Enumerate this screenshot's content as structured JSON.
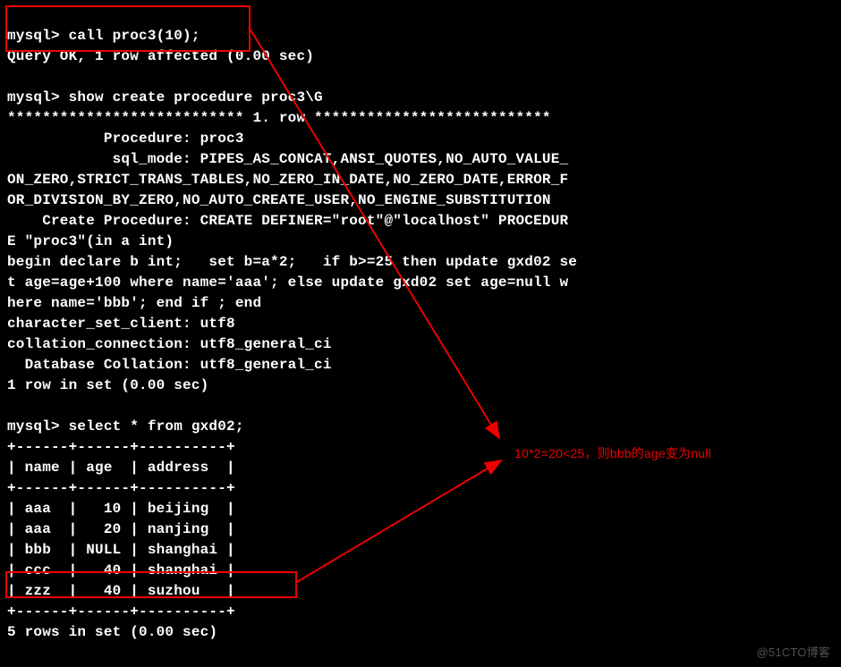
{
  "terminal": {
    "lines": [
      "mysql> call proc3(10);",
      "Query OK, 1 row affected (0.00 sec)",
      "",
      "mysql> show create procedure proc3\\G",
      "*************************** 1. row ***************************",
      "           Procedure: proc3",
      "            sql_mode: PIPES_AS_CONCAT,ANSI_QUOTES,NO_AUTO_VALUE_",
      "ON_ZERO,STRICT_TRANS_TABLES,NO_ZERO_IN_DATE,NO_ZERO_DATE,ERROR_F",
      "OR_DIVISION_BY_ZERO,NO_AUTO_CREATE_USER,NO_ENGINE_SUBSTITUTION",
      "    Create Procedure: CREATE DEFINER=\"root\"@\"localhost\" PROCEDUR",
      "E \"proc3\"(in a int)",
      "begin declare b int;   set b=a*2;   if b>=25 then update gxd02 se",
      "t age=age+100 where name='aaa'; else update gxd02 set age=null w",
      "here name='bbb'; end if ; end",
      "character_set_client: utf8",
      "collation_connection: utf8_general_ci",
      "  Database Collation: utf8_general_ci",
      "1 row in set (0.00 sec)",
      "",
      "mysql> select * from gxd02;",
      "+------+------+----------+",
      "| name | age  | address  |",
      "+------+------+----------+",
      "| aaa  |   10 | beijing  |",
      "| aaa  |   20 | nanjing  |",
      "| bbb  | NULL | shanghai |",
      "| ccc  |   40 | shanghai |",
      "| zzz  |   40 | suzhou   |",
      "+------+------+----------+",
      "5 rows in set (0.00 sec)"
    ]
  },
  "annotation": {
    "text": "10*2=20<25，则bbb的age变为null"
  },
  "watermark": "@51CTO博客",
  "commands": {
    "call": "call proc3(10);",
    "show": "show create procedure proc3\\G",
    "select": "select * from gxd02;"
  },
  "procedure": {
    "name": "proc3",
    "sql_mode": "PIPES_AS_CONCAT,ANSI_QUOTES,NO_AUTO_VALUE_ON_ZERO,STRICT_TRANS_TABLES,NO_ZERO_IN_DATE,NO_ZERO_DATE,ERROR_FOR_DIVISION_BY_ZERO,NO_AUTO_CREATE_USER,NO_ENGINE_SUBSTITUTION",
    "definer": "\"root\"@\"localhost\"",
    "body": "begin declare b int;   set b=a*2;   if b>=25 then update gxd02 set age=age+100 where name='aaa'; else update gxd02 set age=null where name='bbb'; end if ; end",
    "character_set_client": "utf8",
    "collation_connection": "utf8_general_ci",
    "database_collation": "utf8_general_ci"
  },
  "table": {
    "name": "gxd02",
    "columns": [
      "name",
      "age",
      "address"
    ],
    "rows": [
      {
        "name": "aaa",
        "age": "10",
        "address": "beijing"
      },
      {
        "name": "aaa",
        "age": "20",
        "address": "nanjing"
      },
      {
        "name": "bbb",
        "age": "NULL",
        "address": "shanghai"
      },
      {
        "name": "ccc",
        "age": "40",
        "address": "shanghai"
      },
      {
        "name": "zzz",
        "age": "40",
        "address": "suzhou"
      }
    ]
  }
}
